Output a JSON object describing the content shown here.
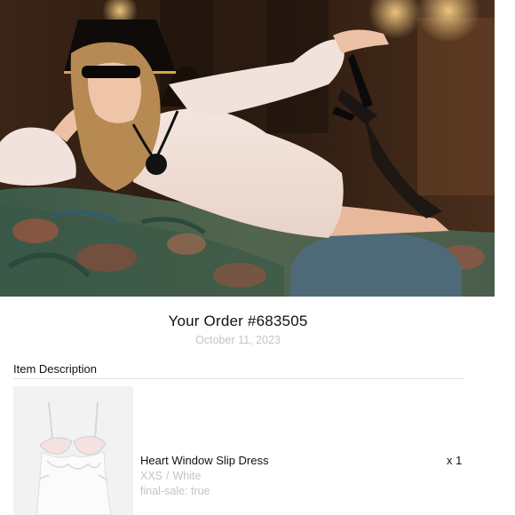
{
  "order": {
    "title": "Your Order #683505",
    "date": "October 11, 2023"
  },
  "items_section": {
    "label": "Item Description"
  },
  "items": [
    {
      "name": "Heart Window Slip Dress",
      "size": "XXS",
      "separator": "/",
      "color": "White",
      "final_sale": "final-sale: true",
      "quantity": "x 1"
    }
  ],
  "colors": {
    "text_primary": "#111111",
    "text_muted": "#c4c4c4",
    "divider": "#e3e3e3"
  }
}
